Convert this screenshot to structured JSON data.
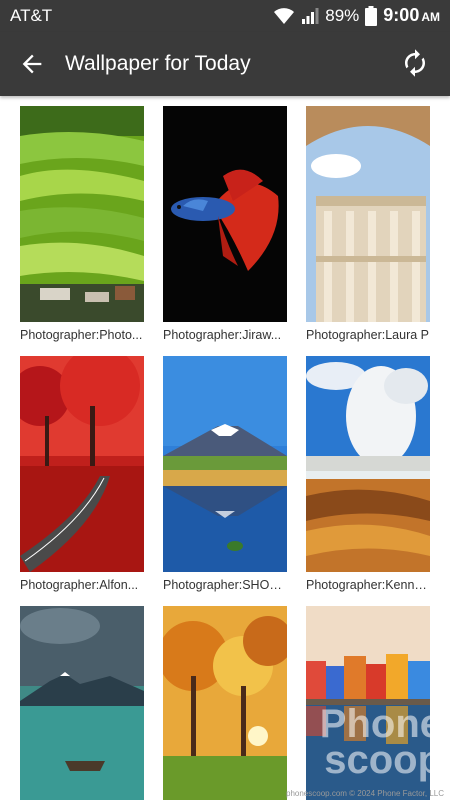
{
  "status_bar": {
    "carrier": "AT&T",
    "battery": "89%",
    "time": "9:00",
    "ampm": "AM",
    "icons": [
      "wifi-icon",
      "signal-icon",
      "battery-icon"
    ]
  },
  "app_bar": {
    "title": "Wallpaper for Today",
    "back_icon": "arrow-left-icon",
    "refresh_icon": "refresh-icon"
  },
  "wallpapers": [
    {
      "caption": "Photographer:Photo..."
    },
    {
      "caption": "Photographer:Jiraw..."
    },
    {
      "caption": "Photographer:Laura P"
    },
    {
      "caption": "Photographer:Alfon..."
    },
    {
      "caption": "Photographer:SHOS..."
    },
    {
      "caption": "Photographer:Kenne..."
    },
    {
      "caption": ""
    },
    {
      "caption": ""
    },
    {
      "caption": ""
    }
  ],
  "watermark": {
    "line1": "Phone",
    "line2": "scoop",
    "credit": "phonescoop.com © 2024 Phone Factor, LLC"
  },
  "colors": {
    "bar": "#3a3a3a",
    "background": "#ffffff"
  }
}
